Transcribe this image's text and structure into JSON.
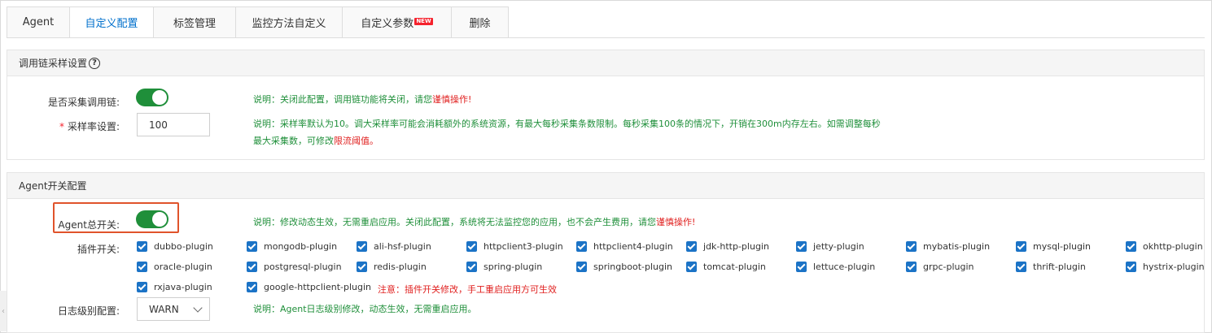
{
  "tabs": [
    {
      "label": "Agent",
      "active": false
    },
    {
      "label": "自定义配置",
      "active": true
    },
    {
      "label": "标签管理",
      "active": false
    },
    {
      "label": "监控方法自定义",
      "active": false
    },
    {
      "label": "自定义参数",
      "active": false,
      "badge": "NEW"
    },
    {
      "label": "删除",
      "active": false
    }
  ],
  "trace_panel": {
    "title": "调用链采样设置",
    "help_icon": "question-circle-icon",
    "collect": {
      "label": "是否采集调用链:",
      "enabled": true,
      "note_prefix": "说明：关闭此配置，调用链功能将关闭，请您",
      "note_danger": "谨慎操作!"
    },
    "sample_rate": {
      "required_mark": "*",
      "label": "采样率设置:",
      "value": "100",
      "note_line1": "说明：采样率默认为10。调大采样率可能会消耗额外的系统资源，有最大每秒采集条数限制。每秒采集100条的情况下，开销在300m内存左右。如需调整每秒",
      "note_line2_prefix": "最大采集数，可修改",
      "note_line2_danger": "限流阈值。"
    }
  },
  "agent_panel": {
    "title": "Agent开关配置",
    "master": {
      "label": "Agent总开关:",
      "enabled": true,
      "note_prefix": "说明：修改动态生效，无需重启应用。关闭此配置，系统将无法监控您的应用，也不会产生费用，请您",
      "note_danger": "谨慎操作!"
    },
    "plugins_label": "插件开关:",
    "plugins": [
      {
        "name": "dubbo-plugin",
        "checked": true
      },
      {
        "name": "mongodb-plugin",
        "checked": true
      },
      {
        "name": "ali-hsf-plugin",
        "checked": true
      },
      {
        "name": "httpclient3-plugin",
        "checked": true
      },
      {
        "name": "httpclient4-plugin",
        "checked": true
      },
      {
        "name": "jdk-http-plugin",
        "checked": true
      },
      {
        "name": "jetty-plugin",
        "checked": true
      },
      {
        "name": "mybatis-plugin",
        "checked": true
      },
      {
        "name": "mysql-plugin",
        "checked": true
      },
      {
        "name": "okhttp-plugin",
        "checked": true
      },
      {
        "name": "oracle-plugin",
        "checked": true
      },
      {
        "name": "postgresql-plugin",
        "checked": true
      },
      {
        "name": "redis-plugin",
        "checked": true
      },
      {
        "name": "spring-plugin",
        "checked": true
      },
      {
        "name": "springboot-plugin",
        "checked": true
      },
      {
        "name": "tomcat-plugin",
        "checked": true
      },
      {
        "name": "lettuce-plugin",
        "checked": true
      },
      {
        "name": "grpc-plugin",
        "checked": true
      },
      {
        "name": "thrift-plugin",
        "checked": true
      },
      {
        "name": "hystrix-plugin",
        "checked": true
      },
      {
        "name": "rxjava-plugin",
        "checked": true
      },
      {
        "name": "google-httpclient-plugin",
        "checked": true
      }
    ],
    "plugins_note": "注意：插件开关修改，手工重启应用方可生效",
    "log_level": {
      "label": "日志级别配置:",
      "value": "WARN",
      "note": "说明：Agent日志级别修改，动态生效，无需重启应用。"
    }
  },
  "colors": {
    "accent": "#0070cc",
    "switch_on": "#1f8f3a",
    "note_green": "#1f8f3a",
    "danger": "#e0201f",
    "checkbox": "#1b73c6",
    "highlight": "#e0532b"
  }
}
